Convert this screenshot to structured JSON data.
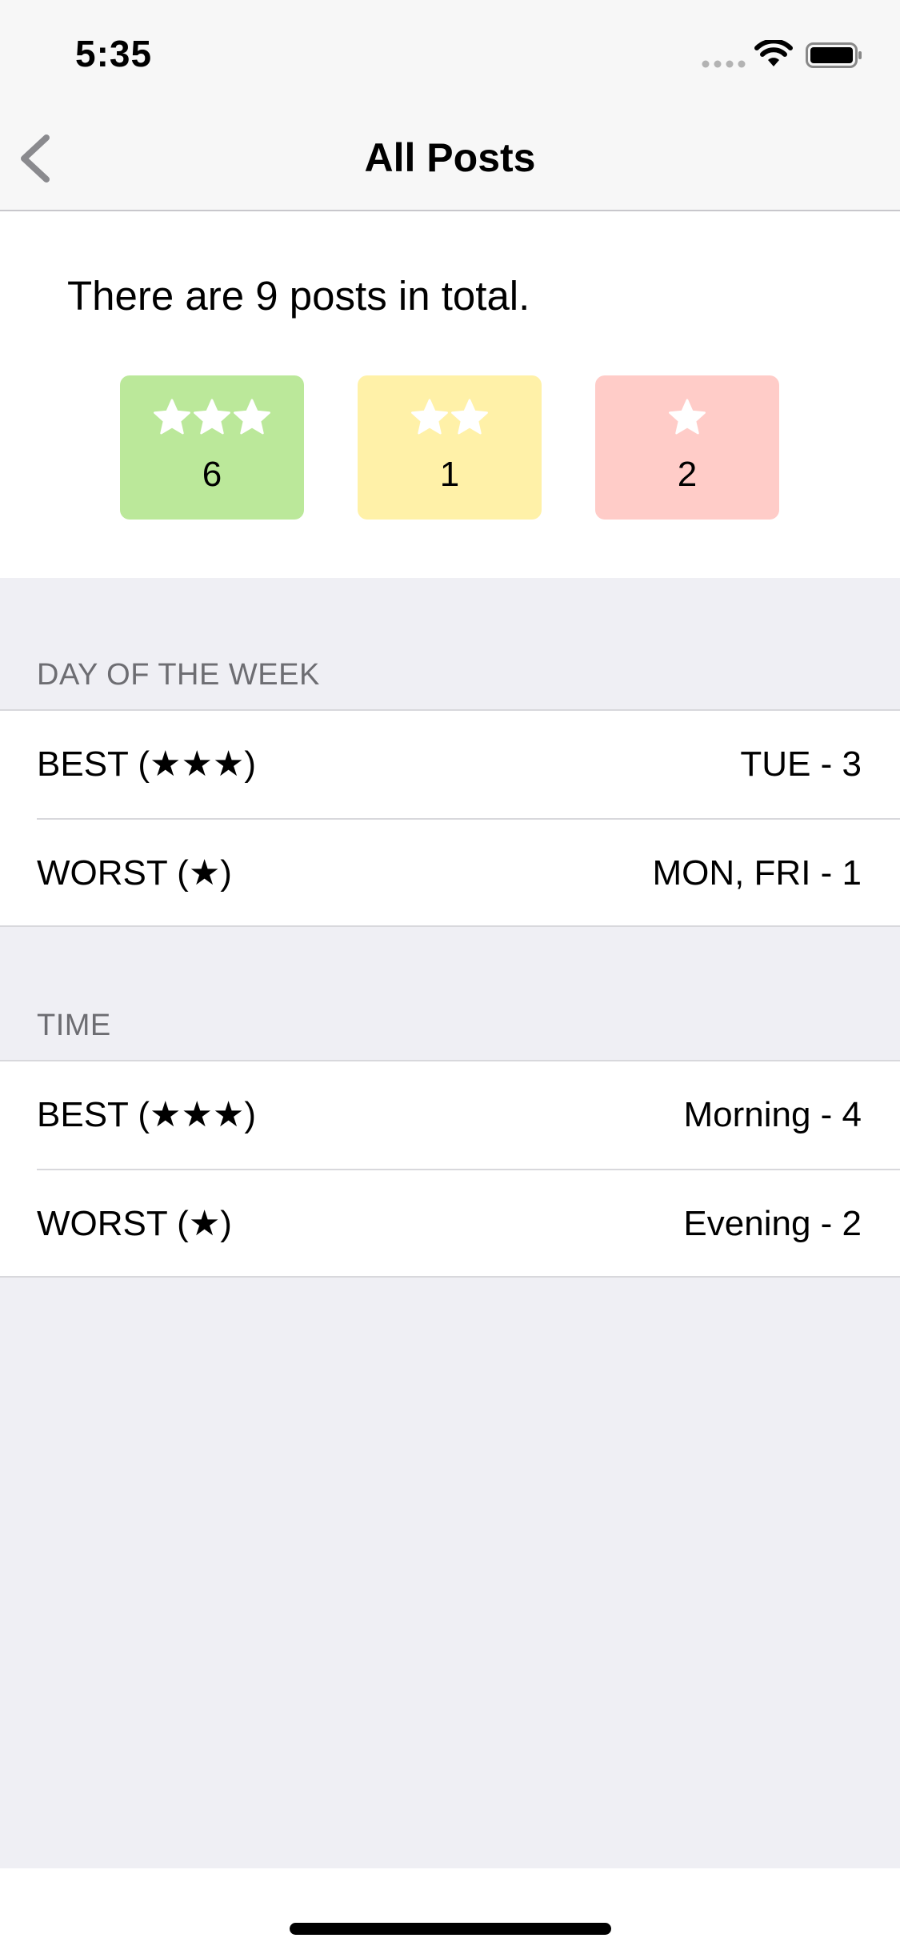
{
  "status_bar": {
    "time": "5:35",
    "icons": [
      "cellular-signal-icon",
      "wifi-icon",
      "battery-icon"
    ]
  },
  "nav": {
    "title": "All Posts",
    "back_icon": "chevron-left-icon"
  },
  "summary": {
    "text": "There are 9 posts in total.",
    "boxes": [
      {
        "stars": 3,
        "count": "6",
        "color": "#bbe89a"
      },
      {
        "stars": 2,
        "count": "1",
        "color": "#fff1a8"
      },
      {
        "stars": 1,
        "count": "2",
        "color": "#ffccc8"
      }
    ]
  },
  "sections": [
    {
      "header": "DAY OF THE WEEK",
      "rows": [
        {
          "label": "BEST (★★★)",
          "value": "TUE - 3"
        },
        {
          "label": "WORST (★)",
          "value": "MON, FRI - 1"
        }
      ]
    },
    {
      "header": "TIME",
      "rows": [
        {
          "label": "BEST (★★★)",
          "value": "Morning - 4"
        },
        {
          "label": "WORST (★)",
          "value": "Evening - 2"
        }
      ]
    }
  ],
  "colors": {
    "grouped_background": "#efeff4",
    "bar_background": "#f7f7f7",
    "separator": "#d8d8dc",
    "section_header_text": "#6d6d72"
  }
}
